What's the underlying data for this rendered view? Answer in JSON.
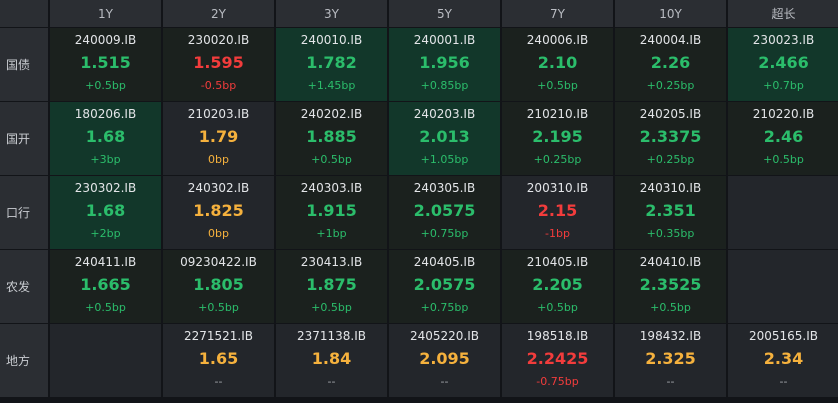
{
  "header": {
    "tenors": [
      "1Y",
      "2Y",
      "3Y",
      "5Y",
      "7Y",
      "10Y",
      "超长"
    ]
  },
  "rows": [
    {
      "label": "国债",
      "cells": [
        {
          "code": "240009.IB",
          "yield": "1.515",
          "change": "+0.5bp",
          "color": "green",
          "bg": "dk"
        },
        {
          "code": "230020.IB",
          "yield": "1.595",
          "change": "-0.5bp",
          "color": "red",
          "bg": "dk"
        },
        {
          "code": "240010.IB",
          "yield": "1.782",
          "change": "+1.45bp",
          "color": "green",
          "bg": "hl"
        },
        {
          "code": "240001.IB",
          "yield": "1.956",
          "change": "+0.85bp",
          "color": "green",
          "bg": "hl"
        },
        {
          "code": "240006.IB",
          "yield": "2.10",
          "change": "+0.5bp",
          "color": "green",
          "bg": "dk"
        },
        {
          "code": "240004.IB",
          "yield": "2.26",
          "change": "+0.25bp",
          "color": "green",
          "bg": "dk"
        },
        {
          "code": "230023.IB",
          "yield": "2.466",
          "change": "+0.7bp",
          "color": "green",
          "bg": "hl"
        }
      ]
    },
    {
      "label": "国开",
      "cells": [
        {
          "code": "180206.IB",
          "yield": "1.68",
          "change": "+3bp",
          "color": "green",
          "bg": "hl"
        },
        {
          "code": "210203.IB",
          "yield": "1.79",
          "change": "0bp",
          "color": "yellow",
          "bg": "plain"
        },
        {
          "code": "240202.IB",
          "yield": "1.885",
          "change": "+0.5bp",
          "color": "green",
          "bg": "dk"
        },
        {
          "code": "240203.IB",
          "yield": "2.013",
          "change": "+1.05bp",
          "color": "green",
          "bg": "hl"
        },
        {
          "code": "210210.IB",
          "yield": "2.195",
          "change": "+0.25bp",
          "color": "green",
          "bg": "dk"
        },
        {
          "code": "240205.IB",
          "yield": "2.3375",
          "change": "+0.25bp",
          "color": "green",
          "bg": "dk"
        },
        {
          "code": "210220.IB",
          "yield": "2.46",
          "change": "+0.5bp",
          "color": "green",
          "bg": "dk"
        }
      ]
    },
    {
      "label": "口行",
      "cells": [
        {
          "code": "230302.IB",
          "yield": "1.68",
          "change": "+2bp",
          "color": "green",
          "bg": "hl"
        },
        {
          "code": "240302.IB",
          "yield": "1.825",
          "change": "0bp",
          "color": "yellow",
          "bg": "plain"
        },
        {
          "code": "240303.IB",
          "yield": "1.915",
          "change": "+1bp",
          "color": "green",
          "bg": "dk"
        },
        {
          "code": "240305.IB",
          "yield": "2.0575",
          "change": "+0.75bp",
          "color": "green",
          "bg": "dk"
        },
        {
          "code": "200310.IB",
          "yield": "2.15",
          "change": "-1bp",
          "color": "red",
          "bg": "plain"
        },
        {
          "code": "240310.IB",
          "yield": "2.351",
          "change": "+0.35bp",
          "color": "green",
          "bg": "dk"
        },
        {
          "code": "",
          "yield": "",
          "change": "",
          "color": "grey",
          "bg": "plain"
        }
      ]
    },
    {
      "label": "农发",
      "cells": [
        {
          "code": "240411.IB",
          "yield": "1.665",
          "change": "+0.5bp",
          "color": "green",
          "bg": "dk"
        },
        {
          "code": "09230422.IB",
          "yield": "1.805",
          "change": "+0.5bp",
          "color": "green",
          "bg": "dk"
        },
        {
          "code": "230413.IB",
          "yield": "1.875",
          "change": "+0.5bp",
          "color": "green",
          "bg": "dk"
        },
        {
          "code": "240405.IB",
          "yield": "2.0575",
          "change": "+0.75bp",
          "color": "green",
          "bg": "dk"
        },
        {
          "code": "210405.IB",
          "yield": "2.205",
          "change": "+0.5bp",
          "color": "green",
          "bg": "dk"
        },
        {
          "code": "240410.IB",
          "yield": "2.3525",
          "change": "+0.5bp",
          "color": "green",
          "bg": "dk"
        },
        {
          "code": "",
          "yield": "",
          "change": "",
          "color": "grey",
          "bg": "plain"
        }
      ]
    },
    {
      "label": "地方",
      "cells": [
        {
          "code": "",
          "yield": "",
          "change": "",
          "color": "grey",
          "bg": "plain"
        },
        {
          "code": "2271521.IB",
          "yield": "1.65",
          "change": "--",
          "color": "yellow",
          "bg": "plain"
        },
        {
          "code": "2371138.IB",
          "yield": "1.84",
          "change": "--",
          "color": "yellow",
          "bg": "plain"
        },
        {
          "code": "2405220.IB",
          "yield": "2.095",
          "change": "--",
          "color": "yellow",
          "bg": "plain"
        },
        {
          "code": "198518.IB",
          "yield": "2.2425",
          "change": "-0.75bp",
          "color": "red",
          "bg": "plain"
        },
        {
          "code": "198432.IB",
          "yield": "2.325",
          "change": "--",
          "color": "yellow",
          "bg": "plain"
        },
        {
          "code": "2005165.IB",
          "yield": "2.34",
          "change": "--",
          "color": "yellow",
          "bg": "plain"
        }
      ]
    }
  ]
}
